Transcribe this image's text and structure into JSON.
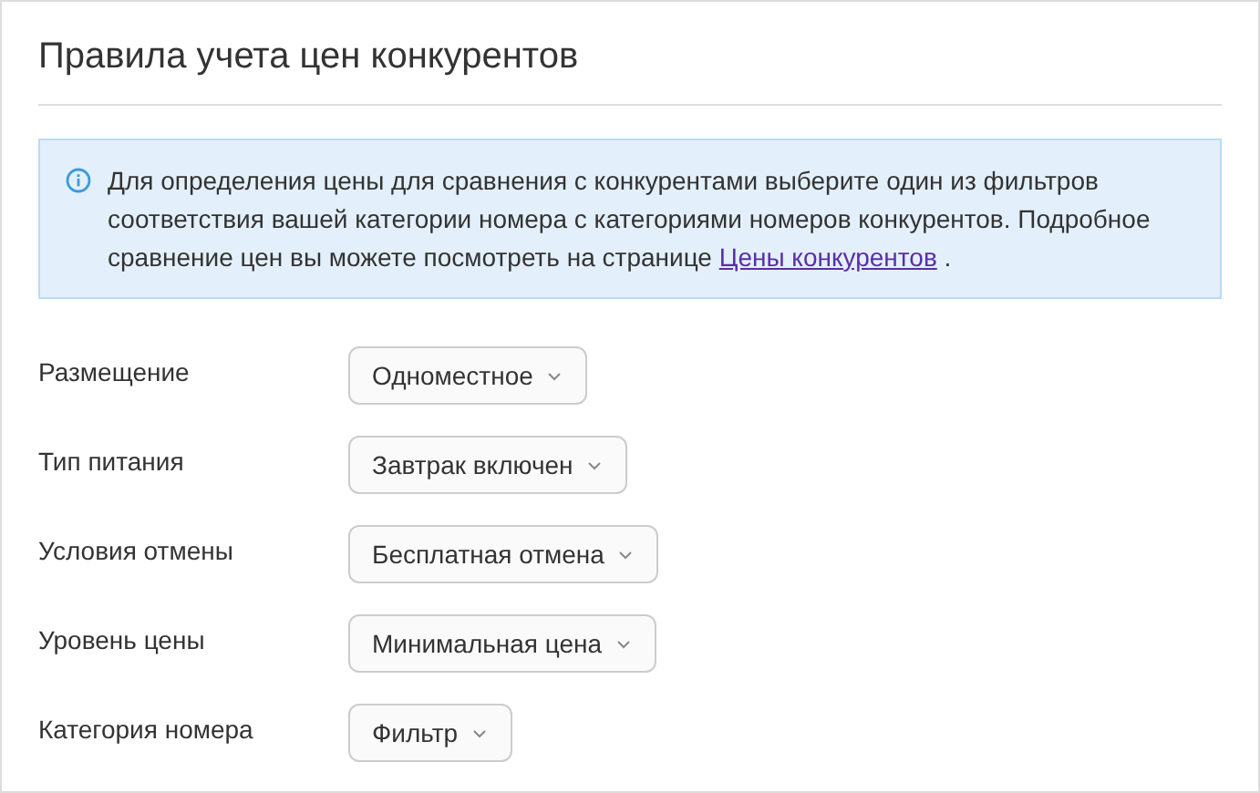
{
  "title": "Правила учета цен конкурентов",
  "info": {
    "text": "Для определения цены для сравнения с конкурентами выберите один из фильтров соответствия вашей категории номера с категориями номеров конкурентов. Подробное сравнение цен вы можете посмотреть на странице",
    "link": "Цены конкурентов",
    "after": "."
  },
  "fields": [
    {
      "label": "Размещение",
      "value": "Одноместное"
    },
    {
      "label": "Тип питания",
      "value": "Завтрак включен"
    },
    {
      "label": "Условия отмены",
      "value": "Бесплатная отмена"
    },
    {
      "label": "Уровень цены",
      "value": "Минимальная цена"
    },
    {
      "label": "Категория номера",
      "value": "Фильтр"
    }
  ]
}
